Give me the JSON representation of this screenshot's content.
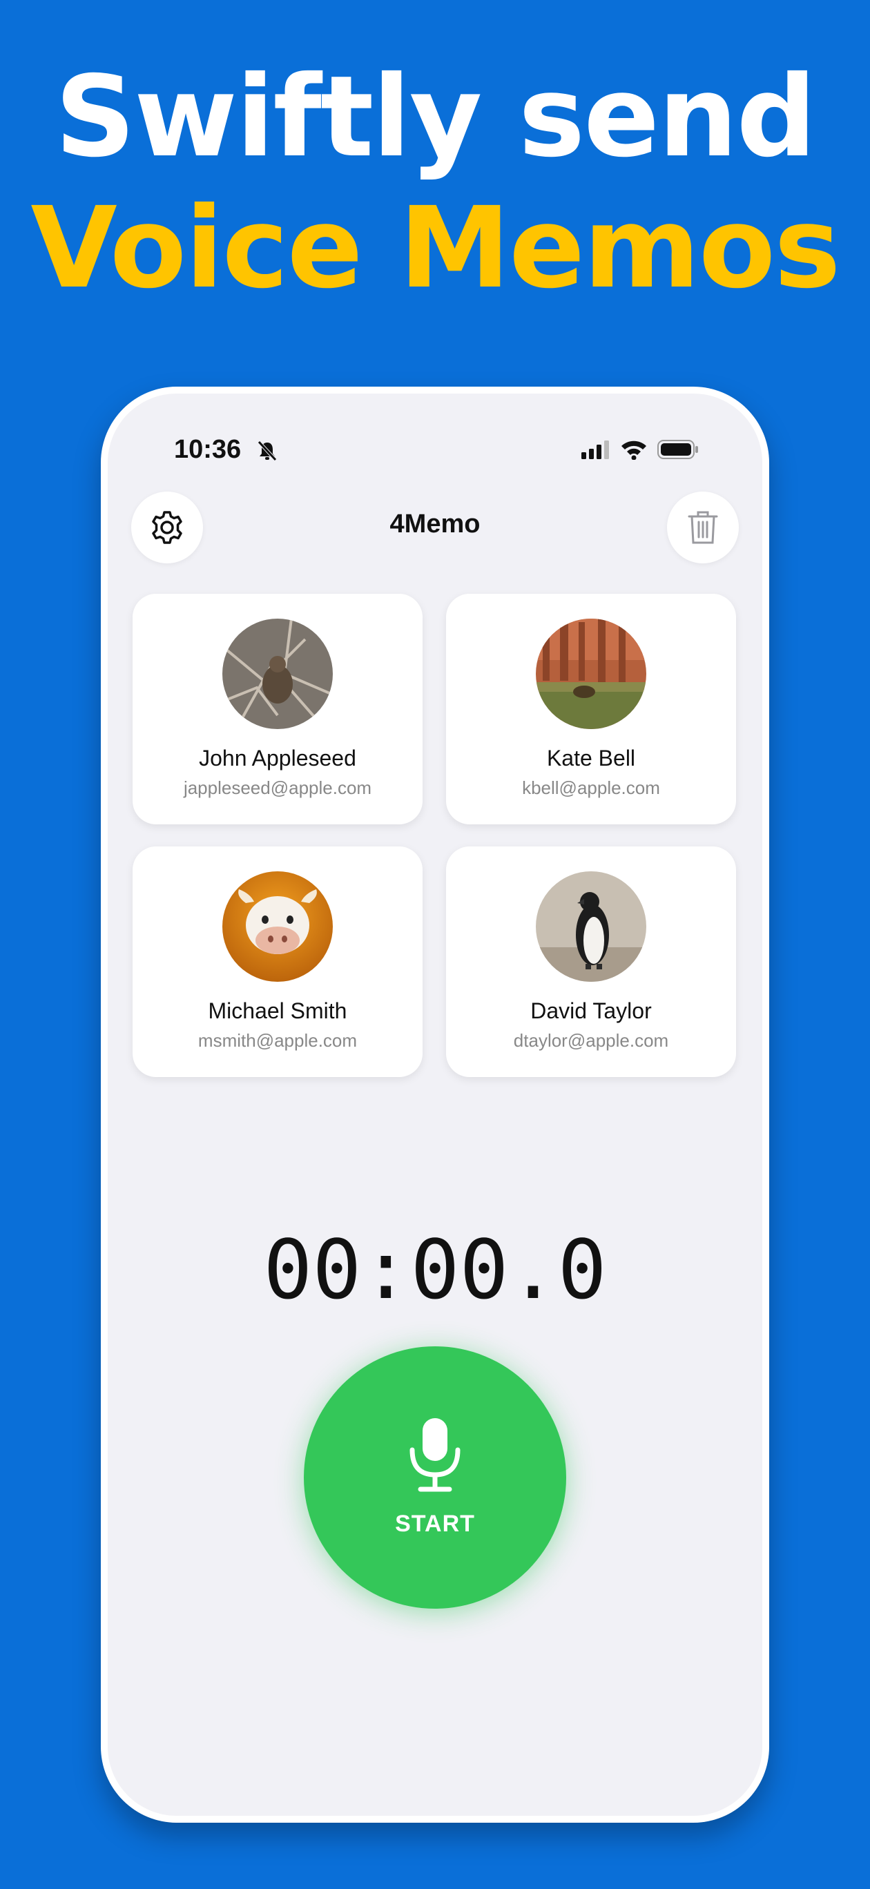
{
  "promo": {
    "headline_line1": "Swiftly send",
    "headline_line2": "Voice Memos",
    "background_color": "#0a6fd8",
    "accent_color": "#ffc400"
  },
  "status_bar": {
    "time": "10:36",
    "icons": [
      "silent-mode-icon",
      "cellular-signal-icon",
      "wifi-icon",
      "battery-icon"
    ]
  },
  "nav": {
    "title": "4Memo",
    "left_icon": "gear-icon",
    "right_icon": "trash-icon"
  },
  "contacts": [
    {
      "name": "John Appleseed",
      "email": "jappleseed@apple.com",
      "avatar": "photo-branches"
    },
    {
      "name": "Kate Bell",
      "email": "kbell@apple.com",
      "avatar": "photo-canyon"
    },
    {
      "name": "Michael Smith",
      "email": "msmith@apple.com",
      "avatar": "memoji-cow"
    },
    {
      "name": "David Taylor",
      "email": "dtaylor@apple.com",
      "avatar": "photo-penguin"
    }
  ],
  "recorder": {
    "timer": "00:00.0",
    "button_label": "START",
    "button_color": "#34c759"
  }
}
